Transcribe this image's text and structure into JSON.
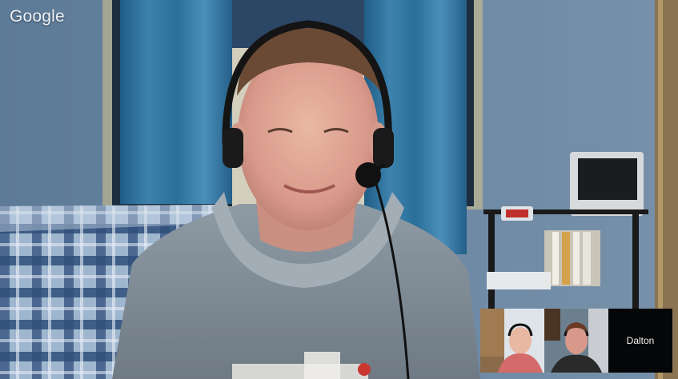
{
  "app": {
    "logo_text": "Google"
  },
  "main_participant": {
    "name": ""
  },
  "filmstrip": [
    {
      "kind": "video",
      "name": ""
    },
    {
      "kind": "video",
      "name": ""
    },
    {
      "kind": "name",
      "name": "Dalton"
    }
  ]
}
